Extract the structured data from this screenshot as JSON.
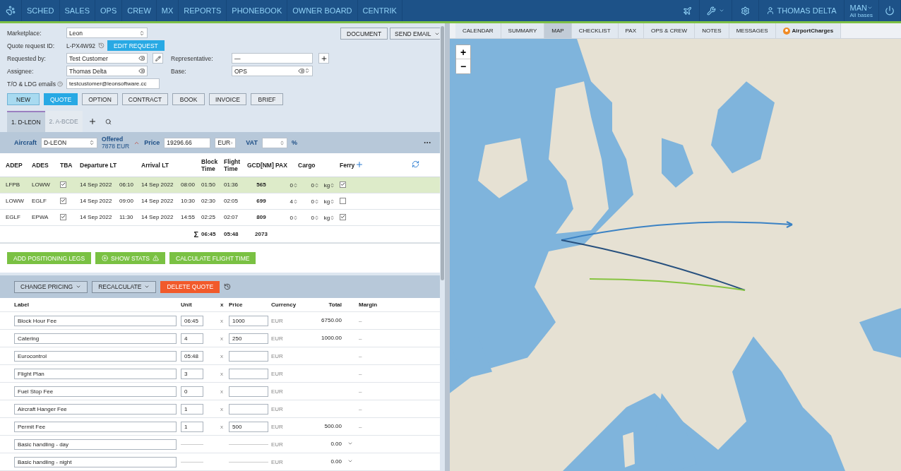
{
  "nav": {
    "items": [
      "SCHED",
      "SALES",
      "OPS",
      "CREW",
      "MX",
      "REPORTS",
      "PHONEBOOK",
      "OWNER BOARD",
      "CENTRIK"
    ],
    "user": "THOMAS DELTA",
    "base": "MAN",
    "base_note": "All bases"
  },
  "request": {
    "marketplace_label": "Marketplace:",
    "marketplace": "Leon",
    "quote_id_label": "Quote request ID:",
    "quote_id": "L-PX4W92",
    "edit_button": "EDIT REQUEST",
    "requested_by_label": "Requested by:",
    "requested_by": "Test Customer",
    "representative_label": "Representative:",
    "representative": "—",
    "assignee_label": "Assignee:",
    "assignee": "Thomas Delta",
    "base_label": "Base:",
    "base": "OPS",
    "emails_label": "T/O & LDG emails",
    "emails": "testcustomer@leonsoftware.cc"
  },
  "top_buttons": [
    "DOCUMENT",
    "SEND EMAIL"
  ],
  "stages": [
    {
      "label": "NEW",
      "done": true,
      "selected": false
    },
    {
      "label": "QUOTE",
      "done": false,
      "selected": true
    },
    {
      "label": "OPTION",
      "done": false,
      "selected": false
    },
    {
      "label": "CONTRACT",
      "done": false,
      "selected": false
    },
    {
      "label": "BOOK",
      "done": false,
      "selected": false
    },
    {
      "label": "INVOICE",
      "done": false,
      "selected": false
    },
    {
      "label": "BRIEF",
      "done": false,
      "selected": false
    }
  ],
  "aircraft_tabs": [
    {
      "label": "1. D-LEON",
      "selected": true
    },
    {
      "label": "2. A-BCDE",
      "selected": false
    }
  ],
  "quote_bar": {
    "aircraft_label": "Aircraft",
    "aircraft": "D-LEON",
    "offered_label": "Offered",
    "offered": "7878 EUR",
    "price_label": "Price",
    "price": "19296.66",
    "currency": "EUR",
    "vat_label": "VAT",
    "vat_unit": "%"
  },
  "legs": {
    "columns": [
      "ADEP",
      "ADES",
      "TBA",
      "Departure LT",
      "Arrival LT",
      "Block Time",
      "Flight Time",
      "GCD[NM]",
      "PAX",
      "Cargo",
      "Ferry"
    ],
    "rows": [
      {
        "adep": "LFPB",
        "ades": "LOWW",
        "tba": true,
        "dep_date": "14 Sep 2022",
        "dep_time": "06:10",
        "arr_date": "14 Sep 2022",
        "arr_time": "08:00",
        "block": "01:50",
        "flight": "01:36",
        "gcd": "565",
        "pax": "0",
        "cargo": "0",
        "cargo_unit": "kg",
        "ferry": true,
        "selected": true
      },
      {
        "adep": "LOWW",
        "ades": "EGLF",
        "tba": true,
        "dep_date": "14 Sep 2022",
        "dep_time": "09:00",
        "arr_date": "14 Sep 2022",
        "arr_time": "10:30",
        "block": "02:30",
        "flight": "02:05",
        "gcd": "699",
        "pax": "4",
        "cargo": "0",
        "cargo_unit": "kg",
        "ferry": false,
        "selected": false
      },
      {
        "adep": "EGLF",
        "ades": "EPWA",
        "tba": true,
        "dep_date": "14 Sep 2022",
        "dep_time": "11:30",
        "arr_date": "14 Sep 2022",
        "arr_time": "14:55",
        "block": "02:25",
        "flight": "02:07",
        "gcd": "809",
        "pax": "0",
        "cargo": "0",
        "cargo_unit": "kg",
        "ferry": true,
        "selected": false
      }
    ],
    "totals": {
      "sign": "Σ",
      "block": "06:45",
      "flight": "05:48",
      "gcd": "2073"
    }
  },
  "leg_actions": [
    "ADD POSITIONING LEGS",
    "SHOW STATS",
    "CALCULATE FLIGHT TIME"
  ],
  "pricing_actions": [
    {
      "label": "CHANGE PRICING",
      "kind": "menu"
    },
    {
      "label": "RECALCULATE",
      "kind": "menu"
    },
    {
      "label": "DELETE QUOTE",
      "kind": "danger"
    }
  ],
  "pricing": {
    "columns": [
      "Label",
      "Unit",
      "x",
      "Price",
      "Currency",
      "Total",
      "Margin"
    ],
    "rows": [
      {
        "kind": "editable",
        "label": "Block Hour Fee",
        "unit": "06:45",
        "times": "x",
        "price": "1000",
        "currency": "EUR",
        "total": "6750.00",
        "margin": "–"
      },
      {
        "kind": "editable",
        "label": "Catering",
        "unit": "4",
        "times": "x",
        "price": "250",
        "currency": "EUR",
        "total": "1000.00",
        "margin": "–"
      },
      {
        "kind": "editable",
        "label": "Eurocontrol",
        "unit": "05:48",
        "times": "x",
        "currency": "EUR",
        "margin": "–"
      },
      {
        "kind": "editable",
        "label": "Flight Plan",
        "unit": "3",
        "times": "x",
        "currency": "EUR",
        "margin": "–"
      },
      {
        "kind": "editable",
        "label": "Fuel Stop Fee",
        "unit": "0",
        "times": "x",
        "currency": "EUR",
        "margin": "–"
      },
      {
        "kind": "editable",
        "label": "Aircraft Hanger Fee",
        "unit": "1",
        "times": "x",
        "currency": "EUR",
        "margin": "–"
      },
      {
        "kind": "editable",
        "label": "Permit Fee",
        "unit": "1",
        "times": "x",
        "price": "500",
        "currency": "EUR",
        "total": "500.00",
        "margin": "–"
      },
      {
        "kind": "fixed",
        "label": "Basic handling - day",
        "currency": "EUR",
        "total": "0.00"
      },
      {
        "kind": "fixed",
        "label": "Basic handling - night",
        "currency": "EUR",
        "total": "0.00"
      }
    ]
  },
  "map": {
    "tabs": [
      {
        "label": "CALENDAR",
        "selected": false,
        "kind": "plain"
      },
      {
        "label": "SUMMARY",
        "selected": false,
        "kind": "plain"
      },
      {
        "label": "MAP",
        "selected": true,
        "kind": "plain"
      },
      {
        "label": "CHECKLIST",
        "selected": false,
        "kind": "plain"
      },
      {
        "label": "PAX",
        "selected": false,
        "kind": "plain"
      },
      {
        "label": "OPS & CREW",
        "selected": false,
        "kind": "plain"
      },
      {
        "label": "NOTES",
        "selected": false,
        "kind": "plain"
      },
      {
        "label": "MESSAGES",
        "selected": false,
        "kind": "plain"
      },
      {
        "label": "AirportCharges",
        "selected": false,
        "kind": "brand"
      }
    ],
    "zoom": [
      "+",
      "−"
    ]
  }
}
